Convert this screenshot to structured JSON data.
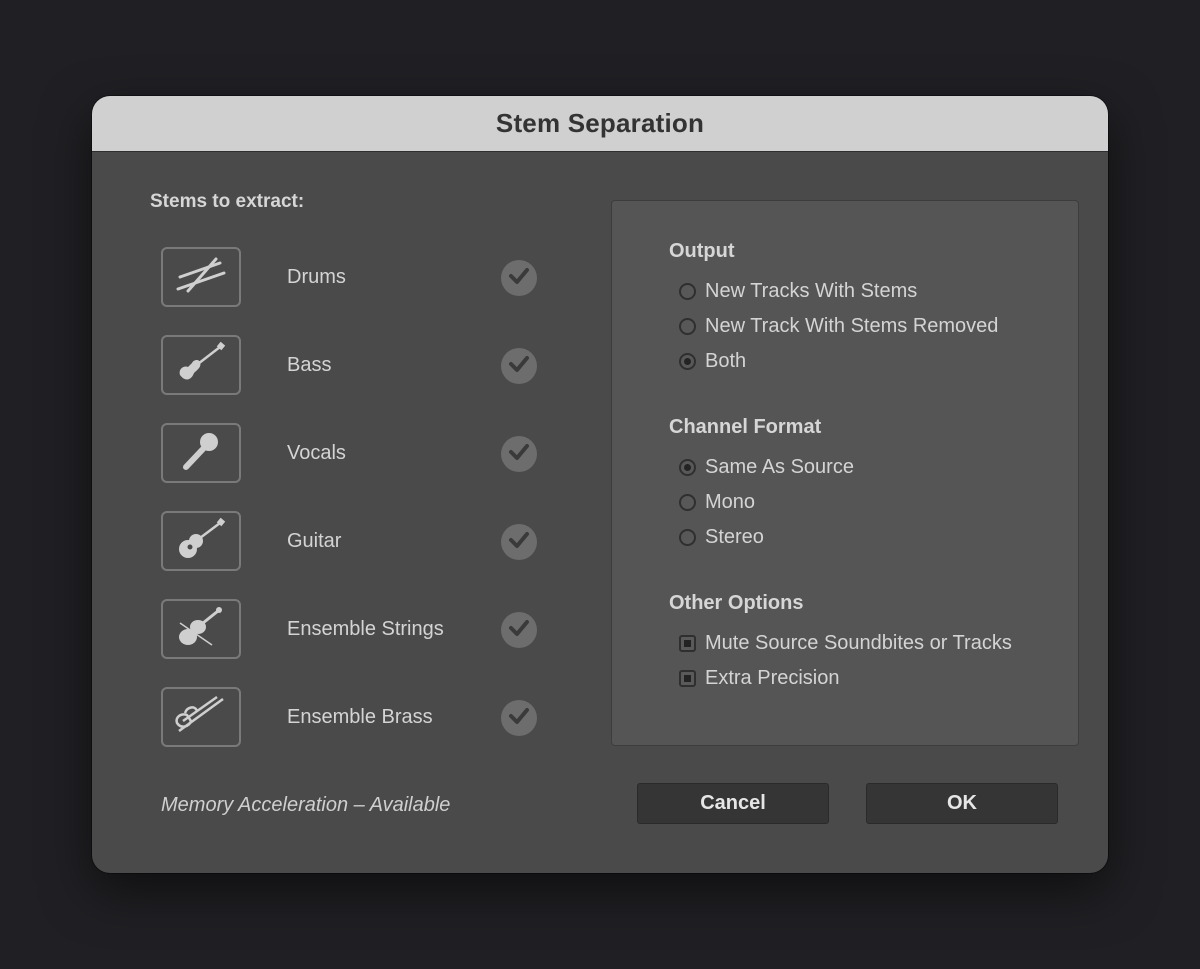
{
  "dialog": {
    "title": "Stem Separation"
  },
  "stems": {
    "heading": "Stems to extract:",
    "items": [
      {
        "label": "Drums",
        "icon": "drumsticks-icon",
        "checked": true
      },
      {
        "label": "Bass",
        "icon": "bass-guitar-icon",
        "checked": true
      },
      {
        "label": "Vocals",
        "icon": "microphone-icon",
        "checked": true
      },
      {
        "label": "Guitar",
        "icon": "acoustic-guitar-icon",
        "checked": true
      },
      {
        "label": "Ensemble Strings",
        "icon": "violin-icon",
        "checked": true
      },
      {
        "label": "Ensemble Brass",
        "icon": "trombone-icon",
        "checked": true
      }
    ]
  },
  "options": {
    "output": {
      "title": "Output",
      "choices": [
        {
          "label": "New Tracks With Stems",
          "selected": false
        },
        {
          "label": "New Track With Stems Removed",
          "selected": false
        },
        {
          "label": "Both",
          "selected": true
        }
      ]
    },
    "channel_format": {
      "title": "Channel Format",
      "choices": [
        {
          "label": "Same As Source",
          "selected": true
        },
        {
          "label": "Mono",
          "selected": false
        },
        {
          "label": "Stereo",
          "selected": false
        }
      ]
    },
    "other": {
      "title": "Other Options",
      "choices": [
        {
          "label": "Mute Source Soundbites or Tracks",
          "checked": true
        },
        {
          "label": "Extra Precision",
          "checked": true
        }
      ]
    }
  },
  "footer": {
    "status": "Memory Acceleration – Available",
    "cancel_label": "Cancel",
    "ok_label": "OK"
  },
  "colors": {
    "dialog_bg": "#4a4a4a",
    "titlebar_bg": "#d0d0d0",
    "panel_bg": "#555555",
    "button_bg": "#353535",
    "page_bg": "#202024"
  }
}
